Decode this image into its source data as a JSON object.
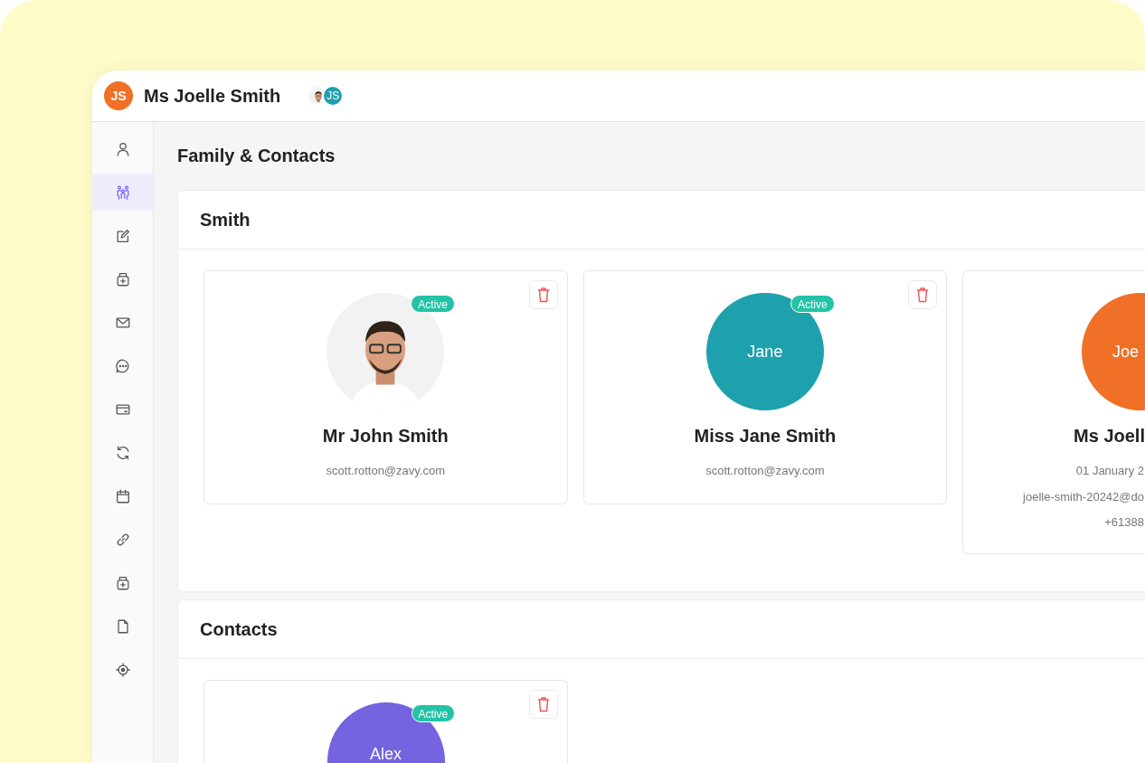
{
  "header": {
    "initials": "JS",
    "title": "Ms Joelle Smith",
    "avatars": [
      {
        "kind": "picture"
      },
      {
        "kind": "initials",
        "label": "JS",
        "color": "#1fa0ad"
      }
    ]
  },
  "sidebar": {
    "items": [
      {
        "selected": false
      },
      {
        "selected": true
      },
      {
        "selected": false
      },
      {
        "selected": false
      },
      {
        "selected": false
      },
      {
        "selected": false
      },
      {
        "selected": false
      },
      {
        "selected": false
      },
      {
        "selected": false
      },
      {
        "selected": false
      },
      {
        "selected": false
      },
      {
        "selected": false
      },
      {
        "selected": false
      }
    ]
  },
  "page_title": "Family & Contacts",
  "sections": [
    {
      "title": "Smith",
      "cards": [
        {
          "avatar": {
            "kind": "picture"
          },
          "status": "Active",
          "name": "Mr John Smith",
          "details": [
            "scott.rotton@zavy.com"
          ]
        },
        {
          "avatar": {
            "kind": "initials",
            "label": "Jane",
            "color": "#1fa0ad"
          },
          "status": "Active",
          "name": "Miss Jane Smith",
          "details": [
            "scott.rotton@zavy.com"
          ]
        },
        {
          "avatar": {
            "kind": "initials",
            "label": "Joe",
            "color": "#f07027"
          },
          "name": "Ms Joell",
          "details": [
            "01 January 2",
            "joelle-smith-20242@do",
            "+61388"
          ]
        }
      ]
    },
    {
      "title": "Contacts",
      "cards": [
        {
          "avatar": {
            "kind": "initials",
            "label": "Alex",
            "color": "#7464e0"
          },
          "status": "Active"
        }
      ]
    }
  ]
}
